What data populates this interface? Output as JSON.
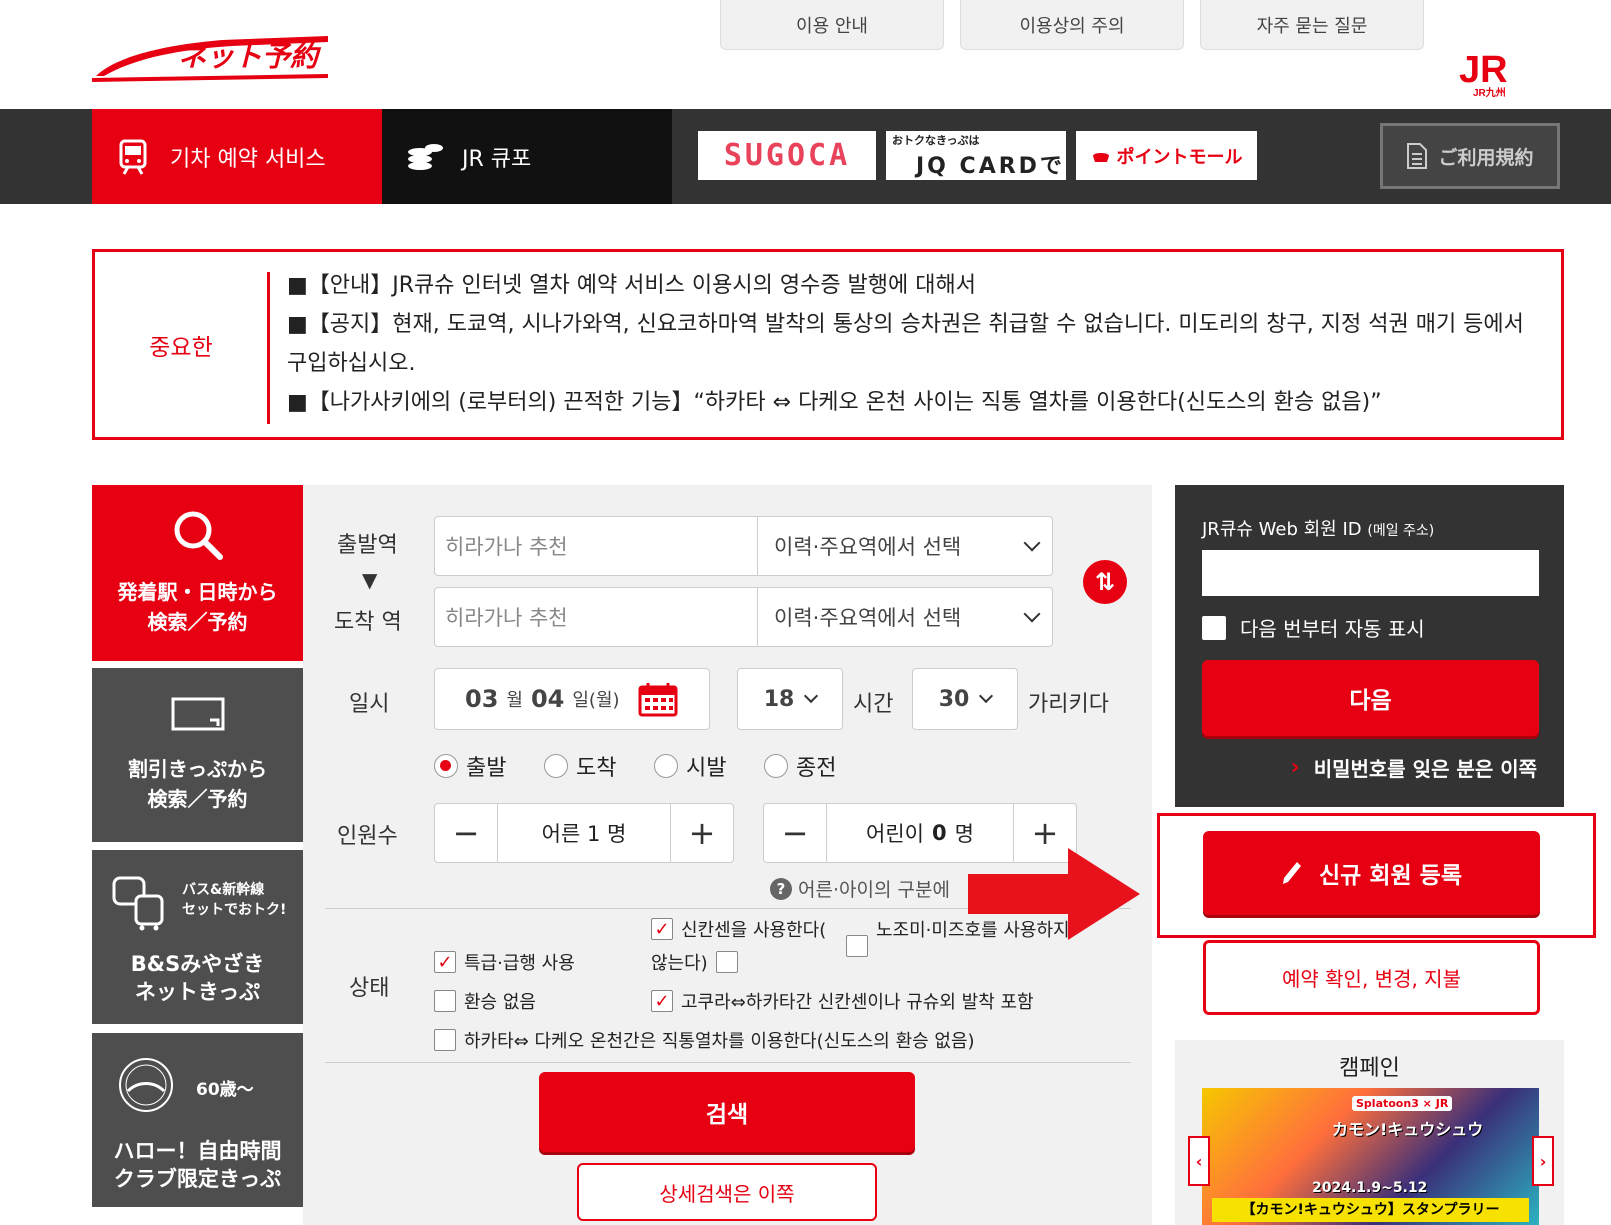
{
  "header": {
    "logo_text": "ネット予約",
    "toplinks": [
      "이용 안내",
      "이용상의 주의",
      "자주 묻는 질문"
    ],
    "jr_logo_main": "JR",
    "jr_logo_sub": "JR九州"
  },
  "nav": {
    "train_label": "기차 예약 서비스",
    "coupon_label": "JR 큐포",
    "sugoca": "SUGOCA",
    "jq_small": "おトクなきっぷは",
    "jq_main": "JQ CARDで",
    "point_mall": "ポイントモール",
    "terms": "ご利用規約"
  },
  "notice": {
    "label": "중요한",
    "lines": [
      "■【안내】JR큐슈 인터넷 열차 예약 서비스 이용시의 영수증 발행에 대해서",
      "■【공지】현재, 도쿄역, 시나가와역, 신요코하마역 발착의 통상의 승차권은 취급할 수 없습니다. 미도리의 창구, 지정 석권 매기 등에서 구입하십시오.",
      "■【나가사키에의 (로부터의) 끈적한 기능】“하카타 ⇔ 다케오 온천 사이는 직통 열차를 이용한다(신도스의 환승 없음)”"
    ]
  },
  "side_menu": [
    {
      "line1": "発着駅・日時から",
      "line2": "検索／予約"
    },
    {
      "line1": "割引きっぷから",
      "line2": "検索／予約"
    },
    {
      "badge1": "バス&新幹線",
      "badge2": "セットでおトク!",
      "line1": "B&Sみやざき",
      "line2": "ネットきっぷ"
    },
    {
      "badge1": "60歳〜",
      "stamp": "ハロー自由時間",
      "line1": "ハロー！自由時間",
      "line2": "クラブ限定きっぷ"
    }
  ],
  "search": {
    "departure_label": "출발역",
    "arrow": "▼",
    "arrival_label": "도착 역",
    "departure_placeholder": "히라가나 추천",
    "arrival_placeholder": "히라가나 추천",
    "history_select": "이력·주요역에서 선택",
    "datetime_label": "일시",
    "month": "03",
    "month_unit": "월",
    "day": "04",
    "day_unit": "일(월)",
    "hour": "18",
    "hour_unit": "시간",
    "minute": "30",
    "minute_unit": "가리키다",
    "radios": [
      "출발",
      "도착",
      "시발",
      "종전"
    ],
    "passengers_label": "인원수",
    "adult": "어른 1 명",
    "child_prefix": "어린이",
    "child_count": "0",
    "child_suffix": "명",
    "help_text": "어른·아이의 구분에",
    "status_label": "상태",
    "opt_express": "특급·급행 사용",
    "opt_shinkansen": "신칸센을 사용한다(",
    "opt_nozomi_1": "노조미·미즈호를 사용하지",
    "opt_nozomi_2": "않는다)",
    "opt_no_transfer": "환승 없음",
    "opt_kokura": "고쿠라⇔하카타간 신칸센이나 규슈외 발착 포함",
    "opt_direct": "하카타⇔ 다케오 온천간은 직통열차를 이용한다(신도스의 환승 없음)",
    "search_btn": "검색",
    "advanced_btn": "상세검색은 이쪽"
  },
  "login": {
    "id_label_1": "JR큐슈 Web 회원 ID",
    "id_label_2": "(메일 주소)",
    "auto_fill": "다음 번부터 자동 표시",
    "next_btn": "다음",
    "forgot": "비밀번호를 잊은 분은 이쪽",
    "register_btn": "신규 회원 등록",
    "confirm_btn": "예약 확인, 변경, 지불"
  },
  "campaign": {
    "title": "캠페인",
    "badge": "Splatoon3 × JR",
    "headline": "カモン!キュウシュウ",
    "date": "2024.1.9~5.12",
    "subtitle": "【カモン!キュウシュウ】スタンプラリー"
  },
  "colors": {
    "accent": "#e60012",
    "dark": "#333333",
    "panel": "#f1f1f1"
  }
}
